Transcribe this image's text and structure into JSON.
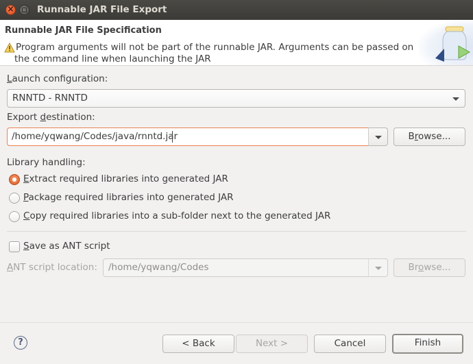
{
  "window": {
    "title": "Runnable JAR File Export",
    "close_icon": "close-icon",
    "maximize_icon": "maximize-icon"
  },
  "header": {
    "title": "Runnable JAR File Specification",
    "warning_icon": "warning-icon",
    "message_line1": "Program arguments will not be part of the runnable JAR. Arguments can be passed on",
    "message_line2": "the command line when launching the JAR",
    "banner_icon": "jar-export-icon"
  },
  "launch_configuration": {
    "label_mnemonic": "L",
    "label_rest": "aunch configuration:",
    "value": "RNNTD - RNNTD"
  },
  "export_destination": {
    "label_before": "Export ",
    "label_mnemonic": "d",
    "label_after": "estination:",
    "value": "/home/yqwang/Codes/java/rnntd.jar",
    "browse_before": "B",
    "browse_mnemonic": "r",
    "browse_after": "owse..."
  },
  "library_handling": {
    "label": "Library handling:",
    "options": [
      {
        "mnemonic": "E",
        "rest": "xtract required libraries into generated JAR",
        "checked": true
      },
      {
        "mnemonic": "P",
        "rest": "ackage required libraries into generated JAR",
        "checked": false
      },
      {
        "mnemonic": "C",
        "rest": "opy required libraries into a sub-folder next to the generated JAR",
        "checked": false
      }
    ]
  },
  "ant": {
    "save_mnemonic": "S",
    "save_rest": "ave as ANT script",
    "save_checked": false,
    "location_mnemonic": "A",
    "location_rest": "NT script location:",
    "location_value": "/home/yqwang/Codes",
    "browse_before": "Br",
    "browse_mnemonic": "o",
    "browse_after": "wse..."
  },
  "footer": {
    "help_icon": "help-icon",
    "help_glyph": "?",
    "back": "< Back",
    "next": "Next >",
    "cancel": "Cancel",
    "finish": "Finish"
  }
}
